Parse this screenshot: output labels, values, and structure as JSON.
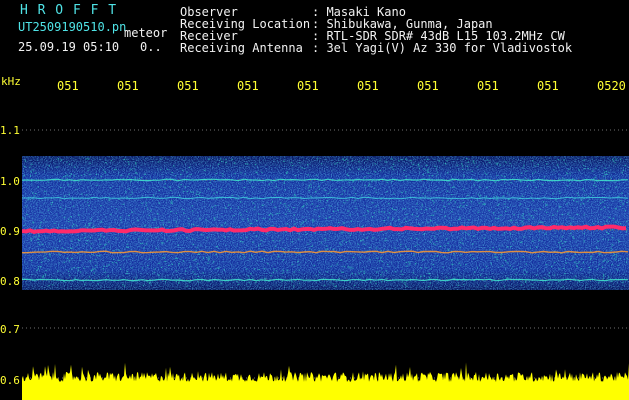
{
  "header": {
    "app_title": "H R O F F T",
    "file_name": "UT2509190510.pn",
    "meteor_label": "meteor",
    "datetime": "25.09.19 05:10",
    "count": "0..",
    "fields": [
      {
        "label": "Observer",
        "value": ": Masaki Kano"
      },
      {
        "label": "Receiving Location",
        "value": ": Shibukawa, Gunma, Japan"
      },
      {
        "label": "Receiver",
        "value": ": RTL-SDR SDR# 43dB L15 103.2MHz CW"
      },
      {
        "label": "Receiving Antenna",
        "value": ": 3el Yagi(V) Az 330 for Vladivostok"
      }
    ]
  },
  "axes": {
    "y_unit": "kHz",
    "y_ticks": [
      "1.1",
      "1.0",
      "0.9",
      "0.8",
      "0.7",
      "0.6"
    ],
    "x_ticks": [
      "051",
      "051",
      "051",
      "051",
      "051",
      "051",
      "051",
      "051",
      "051",
      "0520"
    ]
  },
  "colors": {
    "background": "#000000",
    "band_blue": "#1b3bd6",
    "signal_red": "#ff2a6a",
    "trace_yellow": "#ffff00",
    "grid_dot": "#6f6f6f",
    "label_yellow": "#ffff33",
    "title_cyan": "#4fe3e6"
  }
}
